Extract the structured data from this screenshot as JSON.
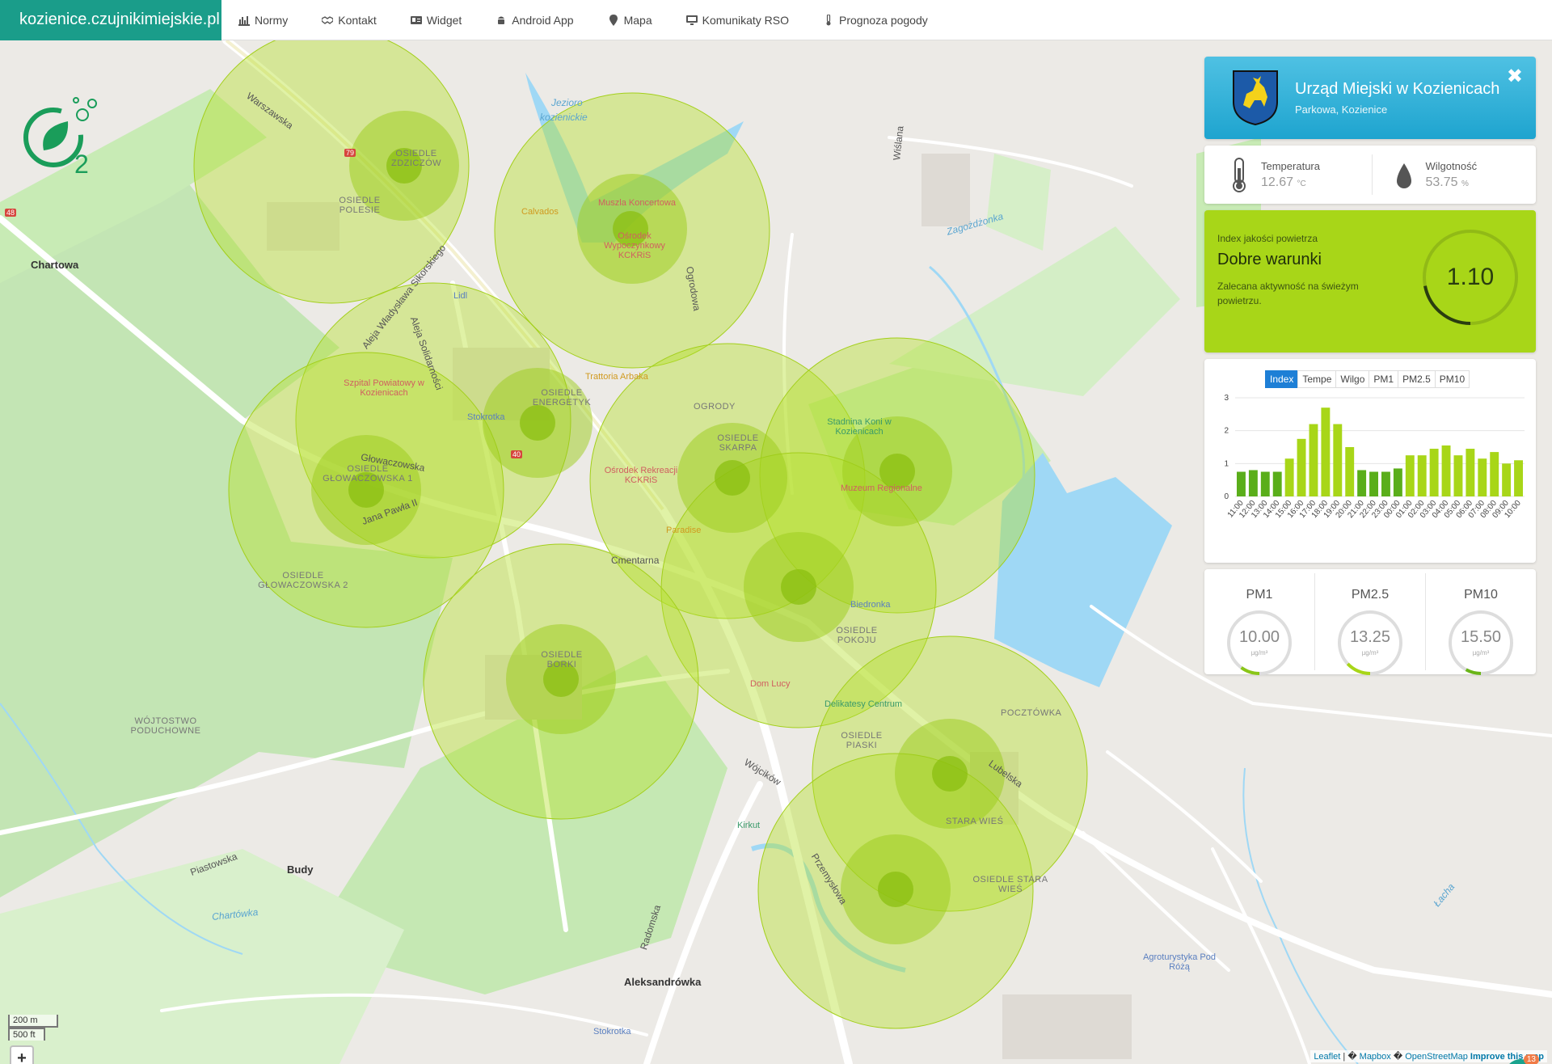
{
  "site": {
    "brand": "kozienice.czujnikimiejskie.pl"
  },
  "nav": [
    {
      "label": "Normy",
      "icon": "chart-icon"
    },
    {
      "label": "Kontakt",
      "icon": "handshake-icon"
    },
    {
      "label": "Widget",
      "icon": "id-card-icon"
    },
    {
      "label": "Android App",
      "icon": "android-icon"
    },
    {
      "label": "Mapa",
      "icon": "map-marker-icon"
    },
    {
      "label": "Komunikaty RSO",
      "icon": "monitor-icon"
    },
    {
      "label": "Prognoza pogody",
      "icon": "thermometer-icon"
    }
  ],
  "map": {
    "labels": {
      "chartowa": "Chartowa",
      "budy": "Budy",
      "aleksandrowka": "Aleksandrówka",
      "jezioro1": "Jezioro",
      "jezioro2": "kozienickie",
      "osiedle_zdziczow": "OSIEDLE ZDZICZÓW",
      "osiedle_polesie": "OSIEDLE POLESIE",
      "osiedle_energetyk": "OSIEDLE ENERGETYK",
      "osiedle_glowaczowska1": "OSIEDLE GŁOWACZOWSKA 1",
      "osiedle_glowaczowska2": "OSIEDLE GŁOWACZOWSKA 2",
      "osiedle_skarpa": "OSIEDLE SKARPA",
      "osiedle_pokoju": "OSIEDLE POKOJU",
      "osiedle_borki": "OSIEDLE BORKI",
      "osiedle_piaski": "OSIEDLE PIASKI",
      "osiedle_stara_wies": "OSIEDLE STARA WIEŚ",
      "stara_wies": "STARA WIEŚ",
      "pocztowka": "POCZTÓWKA",
      "ogrody": "OGRODY",
      "wojtostwo": "WÓJTOSTWO PODUCHOWNE",
      "szpital": "Szpital Powiatowy w Kozienicach",
      "muszla": "Muszla Koncertowa",
      "osrodek": "Ośrodek Wypoczynkowy KCKRiS",
      "osrodek_rek": "Ośrodek Rekreacji KCKRiS",
      "stadnina": "Stadnina Koni w Kozienicach",
      "muzeum": "Muzeum Regionalne",
      "calvados": "Calvados",
      "trattoria": "Trattoria Arbaka",
      "paradise": "Paradise",
      "lidl": "Lidl",
      "stokrotka": "Stokrotka",
      "stokrotka2": "Stokrotka",
      "biedronka": "Biedronka",
      "delikatesy": "Delikatesy Centrum",
      "dom_lucy": "Dom Lucy",
      "kirkut": "Kirkut",
      "agro": "Agroturystyka Pod Różą",
      "warszawska": "Warszawska",
      "glowaczowska": "Głowaczowska",
      "cmentarna": "Cmentarna",
      "wojcikow": "Wójcików",
      "przemyslowa": "Przemysłowa",
      "lubelska": "Lubelska",
      "radomska": "Radomska",
      "wislana": "Wiślana",
      "ogrodowa": "Ogrodowa",
      "piastowska": "Piastowska",
      "solidarnosci": "Aleja Solidarności",
      "sikorskiego": "Aleja Władysława Sikorskiego",
      "jana_pawla": "Jana Pawła II",
      "chartowka": "Chartówka",
      "zagozdzonka": "Zagożdżonka",
      "lacha": "Łacha",
      "r79": "79",
      "r48": "48",
      "r40": "40"
    },
    "scale": {
      "m": "200 m",
      "ft": "500 ft"
    },
    "zoom_in": "+",
    "zoom_out": "−",
    "attribution": {
      "leaflet": "Leaflet",
      "sep1": " | � ",
      "mapbox": "Mapbox",
      "sep2": " � ",
      "osm": "OpenStreetMap",
      "improve": "Improve this map"
    },
    "notif_count": "13"
  },
  "station": {
    "title": "Urząd Miejski w Kozienicach",
    "address": "Parkowa, Kozienice",
    "close": "✖"
  },
  "weather": {
    "temp_label": "Temperatura",
    "temp_value": "12.67",
    "temp_unit": "°C",
    "hum_label": "Wilgotność",
    "hum_value": "53.75",
    "hum_unit": "%"
  },
  "aqi": {
    "small": "Index jakości powietrza",
    "title": "Dobre warunki",
    "desc": "Zalecana aktywność na świeżym powietrzu.",
    "value": "1.10",
    "fraction": 0.22,
    "color": "#a8d618"
  },
  "chart_tabs": [
    "Index",
    "Tempe",
    "Wilgo",
    "PM1",
    "PM2.5",
    "PM10"
  ],
  "chart_data": {
    "type": "bar",
    "categories": [
      "11:00",
      "12:00",
      "13:00",
      "14:00",
      "15:00",
      "16:00",
      "17:00",
      "18:00",
      "19:00",
      "20:00",
      "21:00",
      "22:00",
      "23:00",
      "00:00",
      "01:00",
      "02:00",
      "03:00",
      "04:00",
      "05:00",
      "06:00",
      "07:00",
      "08:00",
      "09:00",
      "10:00"
    ],
    "values": [
      0.75,
      0.8,
      0.75,
      0.75,
      1.15,
      1.75,
      2.2,
      2.7,
      2.2,
      1.5,
      0.8,
      0.75,
      0.75,
      0.85,
      1.25,
      1.25,
      1.45,
      1.55,
      1.25,
      1.45,
      1.15,
      1.35,
      1.0,
      1.1
    ],
    "yticks": [
      "0",
      "1",
      "2",
      "3"
    ],
    "ylim": [
      0,
      3
    ],
    "colors": {
      "dark": "#5aae1a",
      "light": "#a8d618"
    }
  },
  "pm": [
    {
      "label": "PM1",
      "value": "10.00",
      "unit": "µg/m³",
      "fraction": 0.1
    },
    {
      "label": "PM2.5",
      "value": "13.25",
      "unit": "µg/m³",
      "fraction": 0.13
    },
    {
      "label": "PM10",
      "value": "15.50",
      "unit": "µg/m³",
      "fraction": 0.08
    }
  ]
}
